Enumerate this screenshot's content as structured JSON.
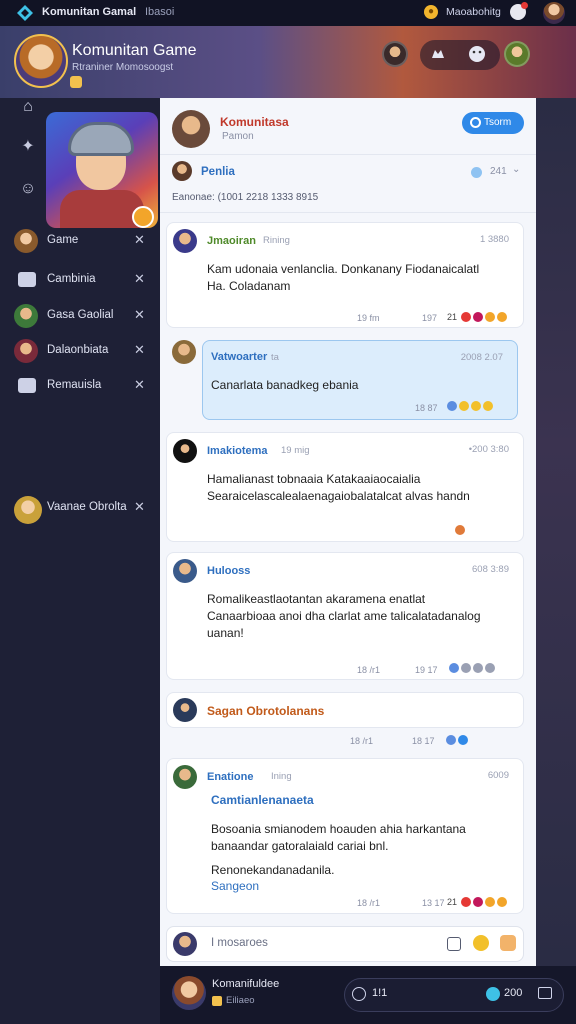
{
  "topbar": {
    "app_name": "Komunitan Gamal",
    "section": "Ibasoi",
    "status": "Maoabohitg"
  },
  "hero": {
    "title": "Komunitan Game",
    "subtitle": "Rtraniner Momosoogst"
  },
  "sidebar": {
    "items": [
      {
        "label": "Game",
        "icon": "avatar"
      },
      {
        "label": "Cambinia",
        "icon": "chat-icon"
      },
      {
        "label": "Gasa Gaolial",
        "icon": "avatar"
      },
      {
        "label": "Dalaonbiata",
        "icon": "avatar"
      },
      {
        "label": "Remauisla",
        "icon": "chat-icon"
      }
    ],
    "bottom_item": {
      "label": "Vaanae Obrolta"
    }
  },
  "panel": {
    "name": "Komunitasa",
    "sub": "Pamon",
    "join_label": "Tsorm",
    "row_label": "Penlia",
    "row_count": "241",
    "meta": "Eanonae: (1001 2218 1333 8915"
  },
  "messages": [
    {
      "author": "Jmaoiran",
      "time": "Rining",
      "right": "1 3880",
      "body": "Kam udonaia venlanclia. Donkanany Fiodanaicalatl Ha. Coladanam",
      "foot_left": "19 fm",
      "foot_mid": "197",
      "foot_num": "21"
    },
    {
      "author": "Vatwoarter",
      "time": "ta",
      "right": "2008 2.07",
      "body": "Canarlata banadkeg ebania",
      "foot_left": "18 87",
      "foot_mid": ""
    },
    {
      "author": "Imakiotema",
      "time": "19 mig",
      "right": "•200 3:80",
      "body": "Hamalianast tobnaaia Katakaaiaocaialia Searaicelascalealaenagaiobalatalcat alvas handn",
      "foot_left": "",
      "foot_mid": ""
    },
    {
      "author": "Hulooss",
      "time": "",
      "right": "608 3:89",
      "body": "Romalikeastlaotantan akaramena enatlat Canaarbioaa anoi dha clarlat ame talicalatadanalog uanan!",
      "foot_left": "18 /r1",
      "foot_mid": "19 17"
    },
    {
      "author": "",
      "time": "",
      "right": "",
      "body": "Sagan Obrotolanans",
      "foot_left": "18 /r1",
      "foot_mid": "18 17"
    },
    {
      "author": "Enatione",
      "time": "Ining",
      "right": "6009",
      "subtitle": "Camtianlenanaeta",
      "body": "Bosoania smianodem hoauden ahia harkantana banaandar gatoralaiald cariai bnl.",
      "body2": "Renonekandanadanila.",
      "body3": "Sangeon",
      "foot_left": "18 /r1",
      "foot_mid": "13 17",
      "foot_num": "21"
    }
  ],
  "composer": {
    "placeholder": "I mosaroes"
  },
  "bottom": {
    "name": "Komanifuldee",
    "sub": "Eiliaeo",
    "pill_a": "1!1",
    "pill_b": "200"
  },
  "colors": {
    "accent": "#2f89e8",
    "highlight_bg": "#dcedfc",
    "name_green": "#4f8a2a",
    "name_blue": "#2e6fbf",
    "name_red": "#c0392b",
    "name_orange": "#c15a1a"
  }
}
